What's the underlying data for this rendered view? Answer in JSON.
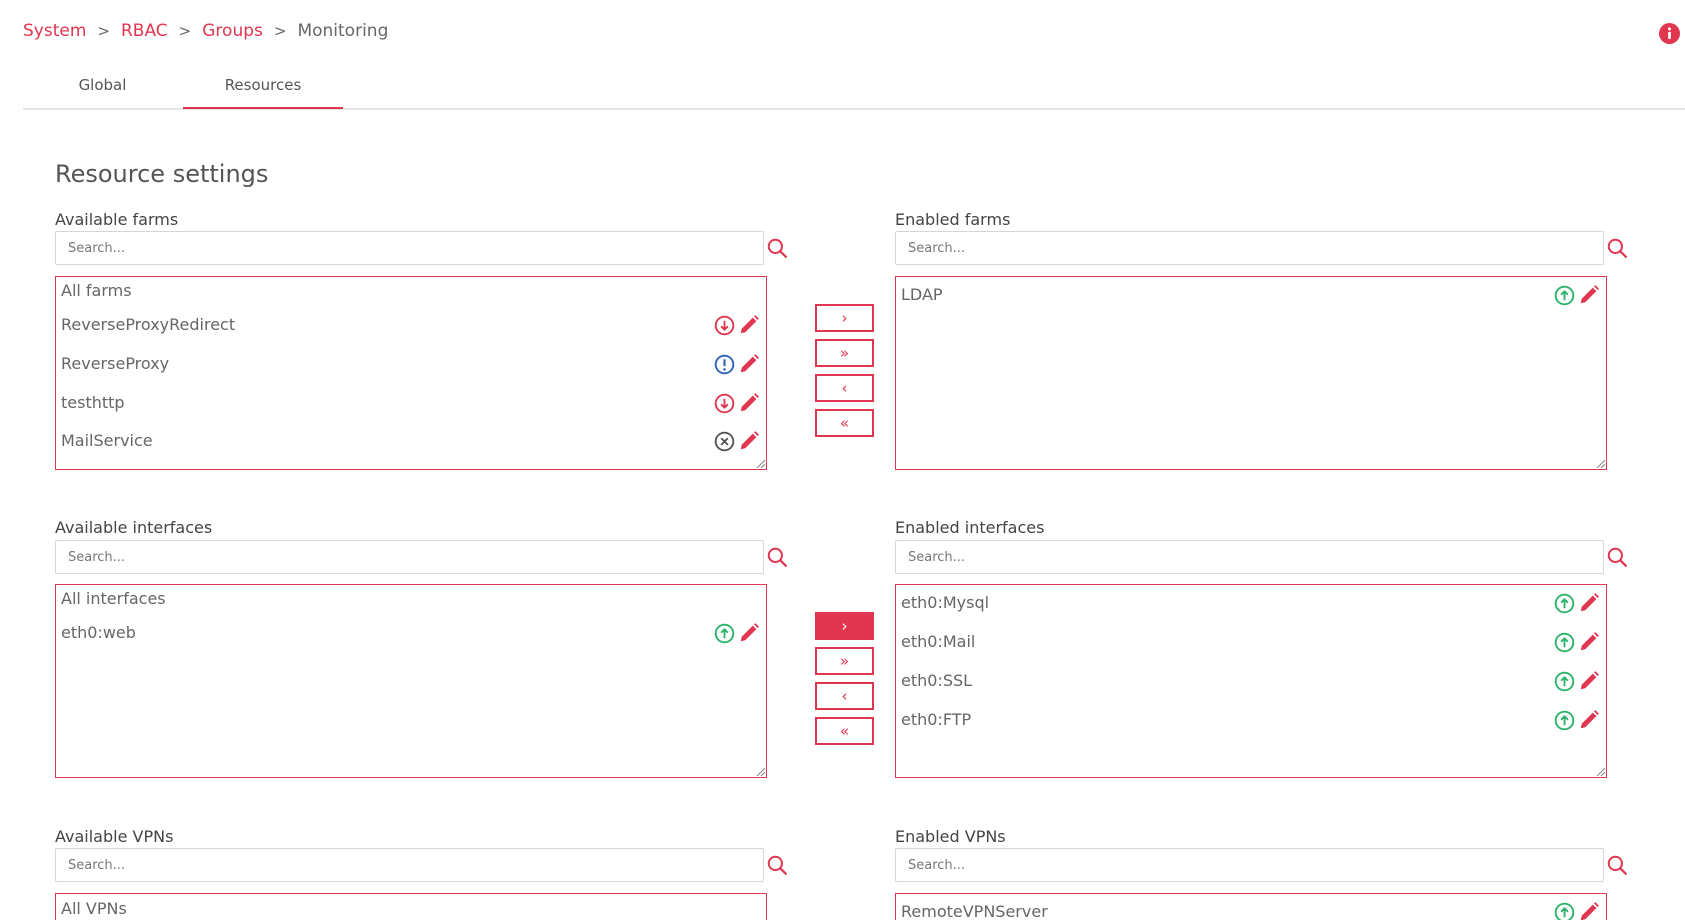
{
  "breadcrumb": {
    "system": "System",
    "rbac": "RBAC",
    "groups": "Groups",
    "current": "Monitoring",
    "separator": ">"
  },
  "tabs": {
    "global": "Global",
    "resources": "Resources",
    "active": "Resources"
  },
  "section_title": "Resource settings",
  "search_placeholder": "Search...",
  "move_buttons": {
    "add": "›",
    "add_all": "»",
    "remove": "‹",
    "remove_all": "«"
  },
  "farms": {
    "available_label": "Available farms",
    "enabled_label": "Enabled farms",
    "available_header": "All farms",
    "available": [
      {
        "name": "ReverseProxyRedirect",
        "status": "down"
      },
      {
        "name": "ReverseProxy",
        "status": "problem"
      },
      {
        "name": "testhttp",
        "status": "down"
      },
      {
        "name": "MailService",
        "status": "stopped"
      }
    ],
    "enabled": [
      {
        "name": "LDAP",
        "status": "up"
      }
    ]
  },
  "interfaces": {
    "available_label": "Available interfaces",
    "enabled_label": "Enabled interfaces",
    "available_header": "All interfaces",
    "available": [
      {
        "name": "eth0:web",
        "status": "up"
      }
    ],
    "enabled": [
      {
        "name": "eth0:Mysql",
        "status": "up"
      },
      {
        "name": "eth0:Mail",
        "status": "up"
      },
      {
        "name": "eth0:SSL",
        "status": "up"
      },
      {
        "name": "eth0:FTP",
        "status": "up"
      }
    ]
  },
  "vpns": {
    "available_label": "Available VPNs",
    "enabled_label": "Enabled VPNs",
    "available_header": "All VPNs",
    "available": [],
    "enabled": [
      {
        "name": "RemoteVPNServer",
        "status": "up"
      }
    ]
  },
  "colors": {
    "accent": "#e0364f",
    "up": "#2cb36b",
    "down": "#e0364f",
    "problem": "#2a62b5",
    "stopped": "#555555"
  },
  "icons": {
    "info": "info-icon",
    "search": "search-icon",
    "edit": "pencil-icon",
    "up": "arrow-up-circle-icon",
    "down": "arrow-down-circle-icon",
    "problem": "exclamation-circle-icon",
    "stopped": "x-circle-icon"
  }
}
